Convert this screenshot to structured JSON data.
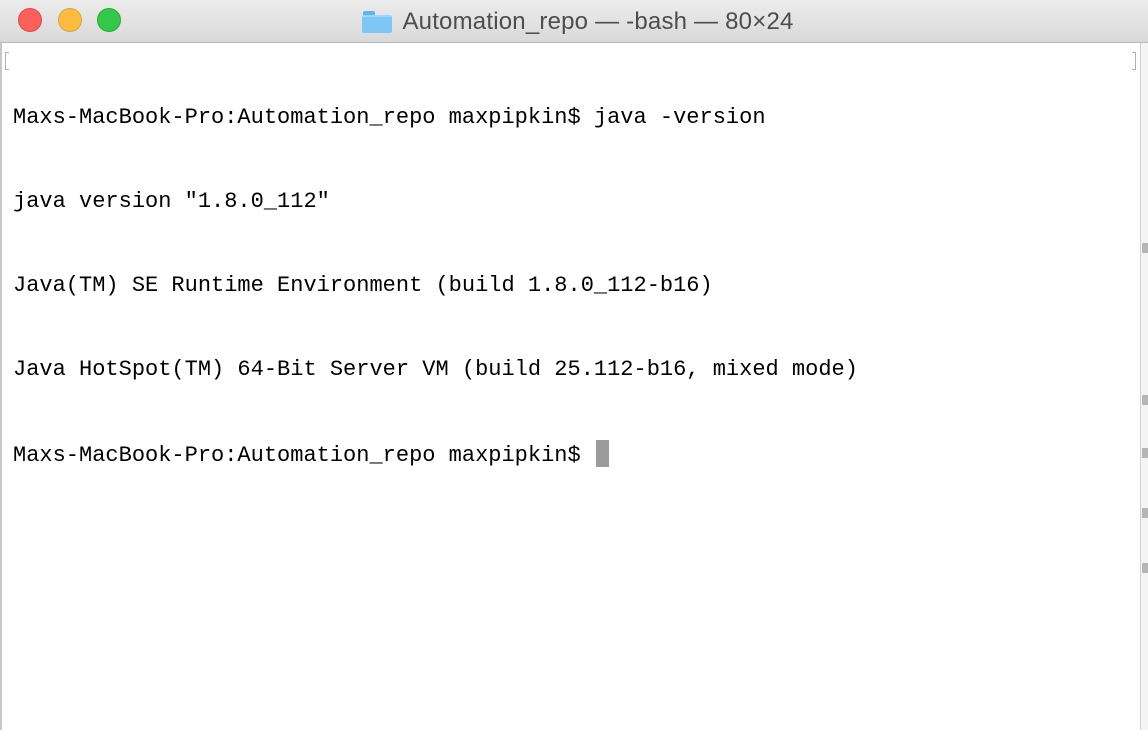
{
  "window": {
    "title": "Automation_repo — -bash — 80×24",
    "folder_icon": "folder-icon"
  },
  "terminal": {
    "lines": [
      "Maxs-MacBook-Pro:Automation_repo maxpipkin$ java -version",
      "java version \"1.8.0_112\"",
      "Java(TM) SE Runtime Environment (build 1.8.0_112-b16)",
      "Java HotSpot(TM) 64-Bit Server VM (build 25.112-b16, mixed mode)"
    ],
    "prompt": "Maxs-MacBook-Pro:Automation_repo maxpipkin$ "
  },
  "colors": {
    "close": "#fc605b",
    "minimize": "#fdbc40",
    "maximize": "#34c84a",
    "cursor": "#9b9b9b",
    "text": "#000000",
    "background": "#ffffff"
  }
}
